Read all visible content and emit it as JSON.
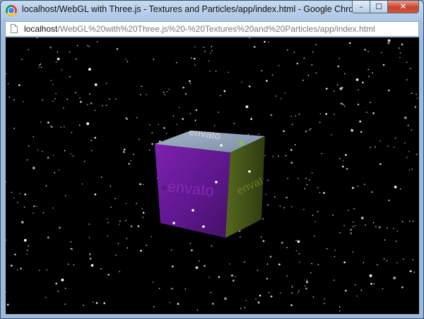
{
  "window": {
    "title": "localhost/WebGL with Three.js - Textures and Particles/app/index.html - Google Chrome",
    "controls": {
      "minimize_glyph": "–",
      "maximize_glyph": "☐",
      "close_glyph": "✕"
    },
    "icon": "chrome-icon"
  },
  "address_bar": {
    "url_host": "localhost",
    "url_path": "/WebGL%20with%20Three.js%20-%20Textures%20and%20Particles/app/index.html",
    "icon": "page-icon"
  },
  "scene": {
    "background": "#000000",
    "cube": {
      "texture_text": "envato",
      "front_color": "#6b1a9c",
      "top_color": "#8fa0b8",
      "side_color": "#4b5e18"
    },
    "particle_color": "#ffffff"
  }
}
